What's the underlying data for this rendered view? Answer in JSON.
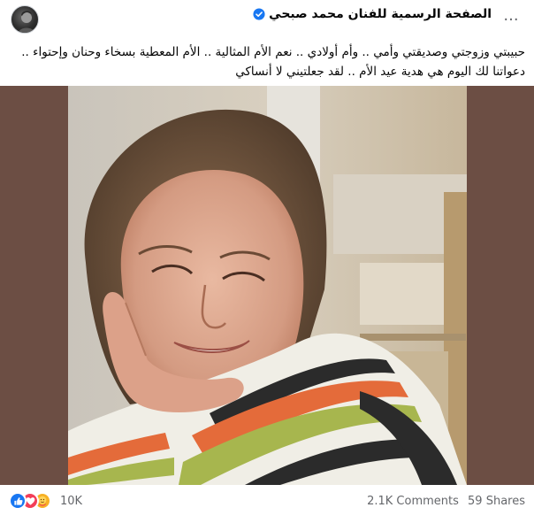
{
  "post": {
    "page_name": "الصفحة الرسمية للفنان محمد صبحي",
    "verified_icon": "verified-badge-icon",
    "more_icon": "more-options-icon",
    "more_label": "···",
    "caption_line1": "حبيبتي وزوجتي وصديقتي وأمي  ..   وأم  أولادي  ..  نعم الأم المثالية  .. الأم المعطية بسخاء وحنان وإحتواء ..",
    "caption_line2": "دعواتنا لك اليوم هي هدية عيد الأم  .. لقد جعلتيني لا أنساكي"
  },
  "reactions": {
    "icons": [
      "like-icon",
      "love-icon",
      "care-icon"
    ],
    "count": "10K",
    "comments": "2.1K Comments",
    "shares": "59 Shares"
  },
  "colors": {
    "photo_background": "#6c4e44",
    "like": "#1877f2",
    "love": "#f33e58",
    "care": "#f7b125",
    "verified": "#1877f2"
  }
}
